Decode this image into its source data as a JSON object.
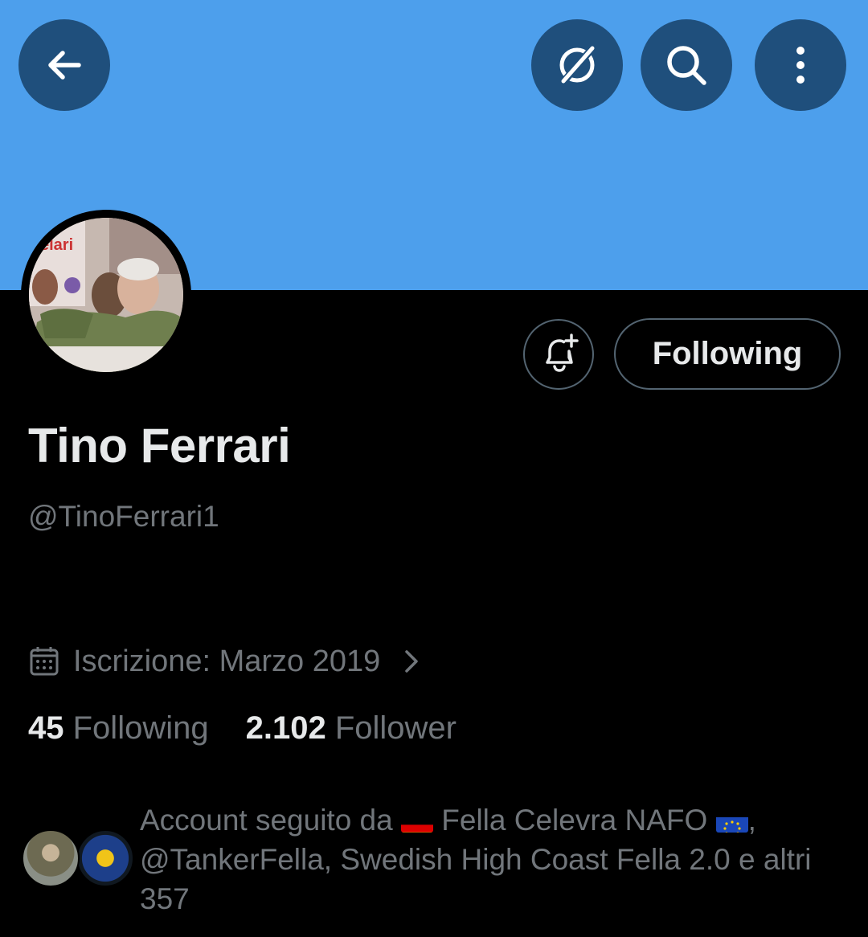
{
  "header": {
    "back_icon": "arrow-left-icon",
    "actions": [
      "grok-icon",
      "search-icon",
      "more-vertical-icon"
    ],
    "banner_color": "#4d9fec"
  },
  "profile": {
    "name": "Tino Ferrari",
    "handle": "@TinoFerrari1",
    "joined": "Iscrizione: Marzo 2019",
    "following_button": "Following",
    "following_count": "45",
    "following_label": "Following",
    "follower_count": "2.102",
    "follower_label": "Follower"
  },
  "followed_by": {
    "prefix": "Account seguito da",
    "name1": "Fella Celevra NAFO",
    "rest": ", @TankerFella, Swedish High Coast Fella 2.0 e altri 357",
    "flag1": "germany-flag-icon",
    "flag2": "eu-flag-icon"
  },
  "colors": {
    "background": "#000000",
    "primary_text": "#e7e9ea",
    "secondary_text": "#71767b",
    "button_circle": "#1f4f7c",
    "border": "#536471"
  }
}
